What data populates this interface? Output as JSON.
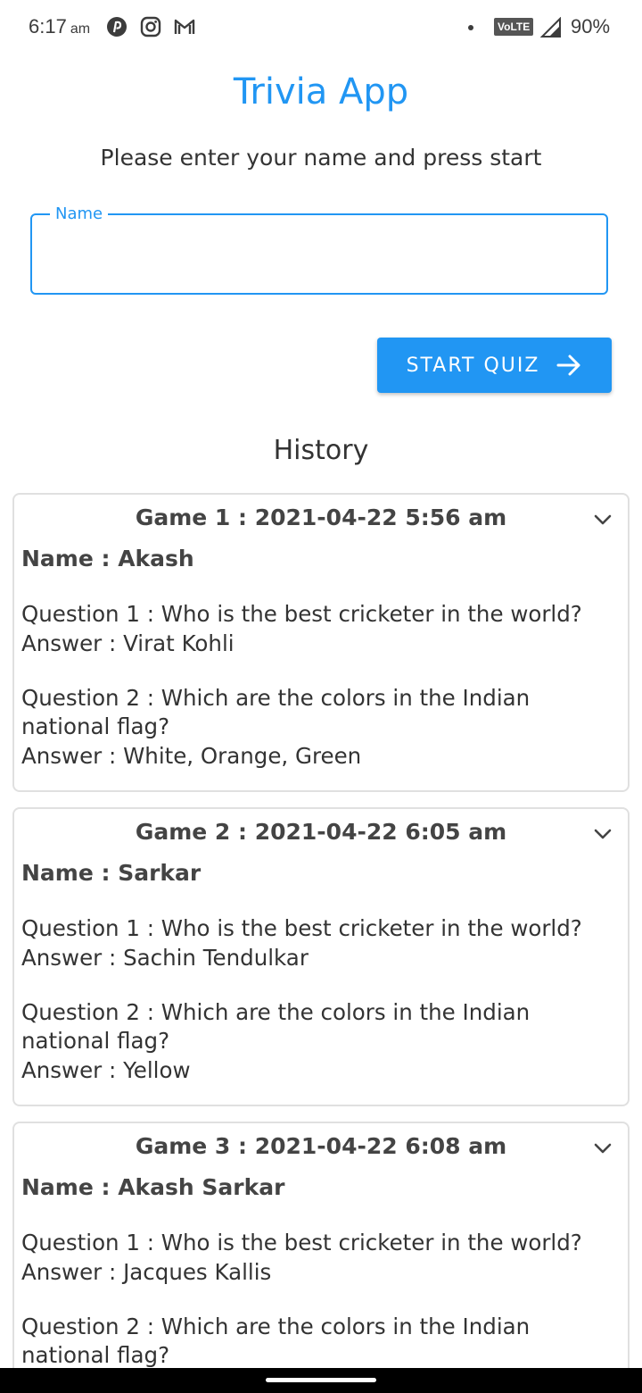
{
  "status_bar": {
    "time": "6:17",
    "ampm": "am",
    "network": "VoLTE",
    "battery": "90%",
    "icons": [
      "pinterest-icon",
      "instagram-icon",
      "gmail-icon",
      "signal-icon"
    ]
  },
  "app": {
    "title": "Trivia App",
    "subtitle": "Please enter your name and press start",
    "accent": "#2196F3"
  },
  "name_field": {
    "label": "Name",
    "value": ""
  },
  "start_button": {
    "label": "START QUIZ",
    "icon": "arrow-right-icon"
  },
  "history": {
    "title": "History",
    "games": [
      {
        "header": "Game 1 : 2021-04-22 5:56 am",
        "name": "Name : Akash",
        "qa": [
          {
            "q": "Question 1 : Who is the best cricketer in the world?",
            "a": "Answer : Virat Kohli"
          },
          {
            "q": "Question 2 : Which are the colors in the Indian national flag?",
            "a": "Answer : White, Orange, Green"
          }
        ]
      },
      {
        "header": "Game 2 : 2021-04-22 6:05 am",
        "name": "Name : Sarkar",
        "qa": [
          {
            "q": "Question 1 : Who is the best cricketer in the world?",
            "a": "Answer : Sachin Tendulkar"
          },
          {
            "q": "Question 2 : Which are the colors in the Indian national flag?",
            "a": "Answer : Yellow"
          }
        ]
      },
      {
        "header": "Game 3 : 2021-04-22 6:08 am",
        "name": "Name : Akash Sarkar",
        "qa": [
          {
            "q": "Question 1 : Who is the best cricketer in the world?",
            "a": "Answer : Jacques Kallis"
          },
          {
            "q": "Question 2 : Which are the colors in the Indian national flag?",
            "a": ""
          }
        ]
      }
    ]
  }
}
